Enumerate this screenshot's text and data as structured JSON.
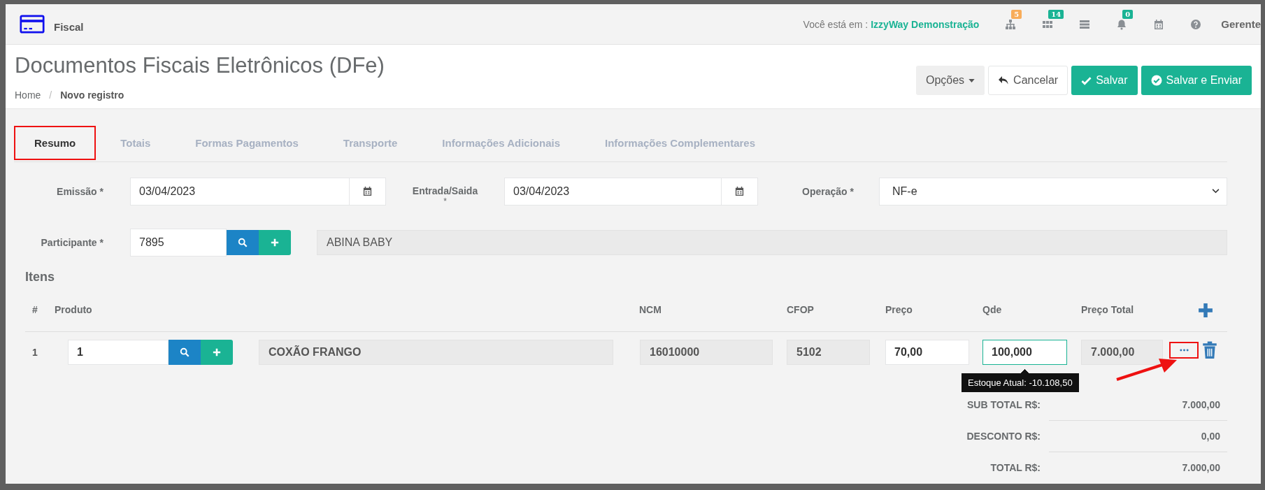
{
  "header": {
    "module": "Fiscal",
    "location_label": "Você está em :",
    "company": "IzzyWay Demonstração",
    "icons": [
      {
        "kind": "sitemap",
        "badge": "5",
        "color": "#f8ac59"
      },
      {
        "kind": "grid",
        "badge": "14",
        "color": "#1ab394"
      },
      {
        "kind": "list"
      },
      {
        "kind": "bell",
        "badge": "0",
        "color": "#1ab394"
      },
      {
        "kind": "calendar"
      },
      {
        "kind": "help"
      }
    ],
    "user": "Gerente"
  },
  "page": {
    "title": "Documentos Fiscais Eletrônicos (DFe)",
    "breadcrumb_separator": "/",
    "breadcrumb": [
      {
        "label": "Home",
        "current": false
      },
      {
        "label": "Novo registro",
        "current": true
      }
    ],
    "actions": [
      {
        "kind": "dropdown",
        "label": "Opções"
      },
      {
        "kind": "cancel",
        "label": "Cancelar"
      },
      {
        "kind": "save",
        "label": "Salvar"
      },
      {
        "kind": "save_send",
        "label": "Salvar e Enviar"
      }
    ]
  },
  "tabs": [
    {
      "label": "Resumo",
      "selected": true
    },
    {
      "label": "Totais",
      "selected": false
    },
    {
      "label": "Formas Pagamentos",
      "selected": false
    },
    {
      "label": "Transporte",
      "selected": false
    },
    {
      "label": "Informações Adicionais",
      "selected": false
    },
    {
      "label": "Informações Complementares",
      "selected": false
    }
  ],
  "form": {
    "emissao": {
      "label": "Emissão *",
      "value": "03/04/2023"
    },
    "entrada_saida": {
      "label": "Entrada/Saida",
      "required_mark": "*",
      "value": "03/04/2023"
    },
    "operacao": {
      "label": "Operação *",
      "value": "NF-e"
    },
    "participante": {
      "label": "Participante *",
      "code": "7895",
      "name": "ABINA BABY"
    }
  },
  "items": {
    "title": "Itens",
    "columns": [
      "#",
      "Produto",
      "NCM",
      "CFOP",
      "Preço",
      "Qde",
      "Preço Total"
    ],
    "rows": [
      {
        "index": "1",
        "product_code": "1",
        "product_name": "COXÃO FRANGO",
        "ncm": "16010000",
        "cfop": "5102",
        "price": "70,00",
        "qty": "100,000",
        "qty_focused": true,
        "total": "7.000,00",
        "tooltip": "Estoque Atual: -10.108,50"
      }
    ]
  },
  "totals": [
    {
      "label": "SUB TOTAL R$:",
      "value": "7.000,00"
    },
    {
      "label": "DESCONTO R$:",
      "value": "0,00"
    },
    {
      "label": "TOTAL R$:",
      "value": "7.000,00"
    }
  ]
}
